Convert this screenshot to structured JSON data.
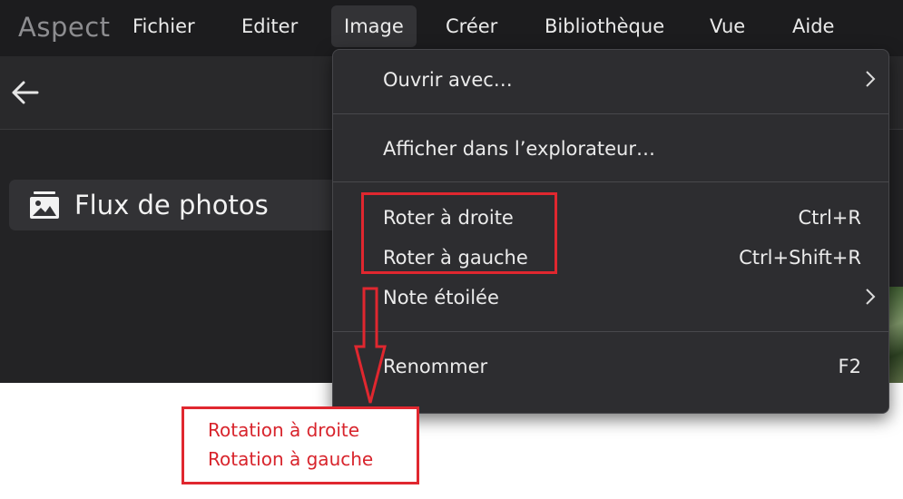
{
  "app": {
    "name": "Aspect"
  },
  "menubar": {
    "items": [
      "Fichier",
      "Editer",
      "Image",
      "Créer",
      "Bibliothèque",
      "Vue",
      "Aide"
    ],
    "active": "Image"
  },
  "sidebar": {
    "item_label": "Flux de photos",
    "item_icon": "photos-icon"
  },
  "toolbar": {
    "back_icon": "back-arrow-icon"
  },
  "image_menu": {
    "open_with": "Ouvrir avec…",
    "show_in_explorer": "Afficher dans l’explorateur…",
    "rotate_right": "Roter à droite",
    "rotate_right_shortcut": "Ctrl+R",
    "rotate_left": "Roter à gauche",
    "rotate_left_shortcut": "Ctrl+Shift+R",
    "star_rating": "Note étoilée",
    "rename": "Renommer",
    "rename_shortcut": "F2"
  },
  "annotation": {
    "line1": "Rotation à droite",
    "line2": "Rotation à gauche",
    "color": "#e0272f"
  },
  "colors": {
    "background": "#232325",
    "menubar": "#1c1c1e",
    "menu_panel": "#2d2d30",
    "text": "#ebebeb"
  }
}
